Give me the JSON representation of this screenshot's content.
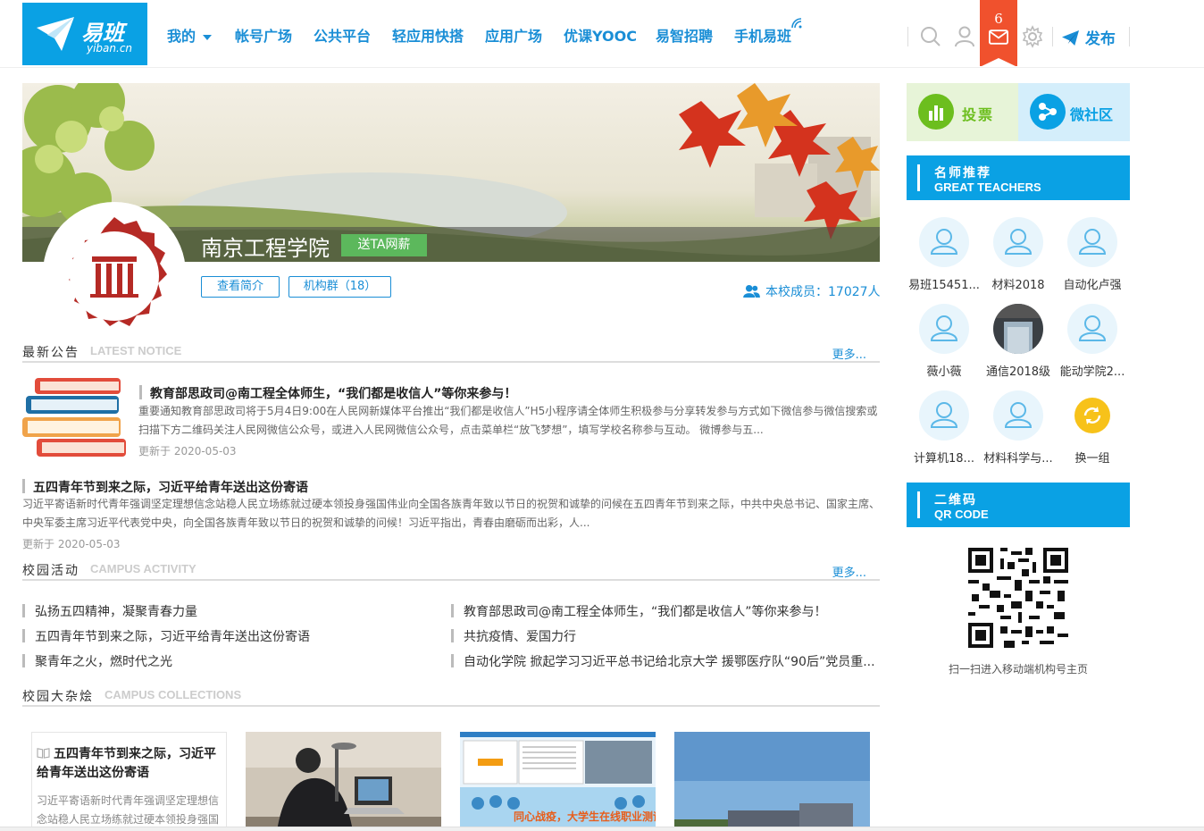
{
  "header": {
    "logo_text": "易班",
    "logo_sub": "yiban.cn",
    "nav": [
      {
        "label": "我的"
      },
      {
        "label": "帐号广场"
      },
      {
        "label": "公共平台"
      },
      {
        "label": "轻应用快搭"
      },
      {
        "label": "应用广场"
      },
      {
        "label": "优课YOOC"
      },
      {
        "label": "易智招聘"
      },
      {
        "label": "手机易班"
      }
    ],
    "mail_count": "6",
    "publish_label": "发布",
    "icons": [
      "search-icon",
      "user-icon",
      "mail-icon",
      "settings-icon",
      "paper-plane-icon"
    ],
    "accent": "#1a8ed6",
    "brand": "#0aa1e4",
    "mail_color": "#f0512d"
  },
  "profile": {
    "school_name": "南京工程学院",
    "salary_button": "送TA网薪",
    "intro_button": "查看简介",
    "group_button": "机构群（18）",
    "members_label": "本校成员：",
    "members_count": "17027人",
    "logo_ring_text": "Nanjing Institute of Technology",
    "logo_seal_text": "南京工程学院"
  },
  "notices": {
    "title": "最新公告",
    "title_en": "LATEST NOTICE",
    "more": "更多...",
    "items": [
      {
        "title": "教育部思政司@南工程全体师生，“我们都是收信人”等你来参与！",
        "body": "重要通知教育部思政司将于5月4日9:00在人民网新媒体平台推出“我们都是收信人”H5小程序请全体师生积极参与分享转发参与方式如下微信参与微信搜索或扫描下方二维码关注人民网微信公众号，或进入人民网微信公众号，点击菜单栏“放飞梦想”，填写学校名称参与互动。 微博参与五...",
        "date": "更新于 2020-05-03"
      },
      {
        "title": "五四青年节到来之际，习近平给青年送出这份寄语",
        "body": "习近平寄语新时代青年强调坚定理想信念站稳人民立场练就过硬本领投身强国伟业向全国各族青年致以节日的祝贺和诚挚的问候在五四青年节到来之际，中共中央总书记、国家主席、中央军委主席习近平代表党中央，向全国各族青年致以节日的祝贺和诚挚的问候！习近平指出，青春由磨砺而出彩，人...",
        "date": "更新于 2020-05-03"
      }
    ]
  },
  "activity": {
    "title": "校园活动",
    "title_en": "CAMPUS ACTIVITY",
    "more": "更多...",
    "items": [
      "弘扬五四精神，凝聚青春力量",
      "教育部思政司@南工程全体师生，“我们都是收信人”等你来参与！",
      "五四青年节到来之际，习近平给青年送出这份寄语",
      "共抗疫情、爱国力行",
      "聚青年之火，燃时代之光",
      "自动化学院 掀起学习习近平总书记给北京大学 援鄂医疗队“90后”党员重..."
    ]
  },
  "collections": {
    "title": "校园大杂烩",
    "title_en": "CAMPUS COLLECTIONS",
    "card_title": "五四青年节到来之际，习近平给青年送出这份寄语",
    "card_body": "习近平寄语新时代青年强调坚定理想信念站稳人民立场练就过硬本领投身强国",
    "image_caption": "同心战疫，大学生在线职业测评与规划"
  },
  "sidebar": {
    "vote_label": "投票",
    "community_label": "微社区",
    "teachers_title": "名师推荐",
    "teachers_title_en": "GREAT TEACHERS",
    "teachers": [
      "易班15451...",
      "材料2018",
      "自动化卢强",
      "薇小薇",
      "通信2018级",
      "能动学院2...",
      "计算机18...",
      "材料科学与...",
      "换一组"
    ],
    "qr_title": "二维码",
    "qr_title_en": "QR CODE",
    "qr_caption": "扫一扫进入移动端机构号主页"
  }
}
